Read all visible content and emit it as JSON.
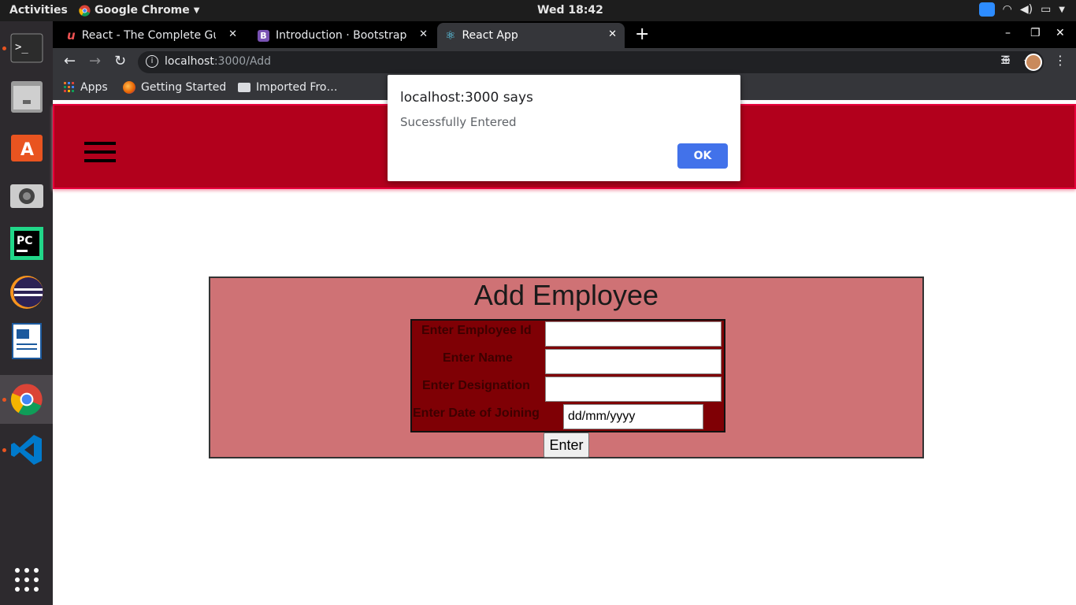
{
  "topbar": {
    "activities": "Activities",
    "app_name": "Google Chrome",
    "clock": "Wed 18:42"
  },
  "dock": {
    "items": [
      "terminal-icon",
      "files-icon",
      "software-center-icon",
      "camera-icon",
      "pycharm-icon",
      "eclipse-icon",
      "libreoffice-writer-icon",
      "chrome-icon",
      "vscode-icon"
    ],
    "show_apps_icon": "app-grid-icon"
  },
  "tabs": [
    {
      "title": "React - The Complete Guid",
      "icon": "udemy-icon",
      "active": false
    },
    {
      "title": "Introduction · Bootstrap v",
      "icon": "bootstrap-icon",
      "active": false
    },
    {
      "title": "React App",
      "icon": "react-icon",
      "active": true
    }
  ],
  "omnibox": {
    "host": "localhost",
    "path": ":3000/Add"
  },
  "bookmarks": [
    {
      "label": "Apps",
      "icon": "apps-grid-icon"
    },
    {
      "label": "Getting Started",
      "icon": "firefox-icon"
    },
    {
      "label": "Imported Fro…",
      "icon": "folder-icon"
    }
  ],
  "form": {
    "title": "Add Employee",
    "fields": [
      {
        "label": "Enter Employee Id",
        "value": ""
      },
      {
        "label": "Enter Name",
        "value": ""
      },
      {
        "label": "Enter Designation",
        "value": ""
      },
      {
        "label": "Enter Date of Joining",
        "placeholder": "dd/mm/yyyy"
      }
    ],
    "submit_label": "Enter"
  },
  "dialog": {
    "title": "localhost:3000 says",
    "message": "Sucessfully Entered",
    "ok_label": "OK",
    "ok_color": "#4272ea"
  },
  "colors": {
    "navbar": "#b2001c",
    "form_box": "#cf7275",
    "form_table": "#7f0005"
  }
}
